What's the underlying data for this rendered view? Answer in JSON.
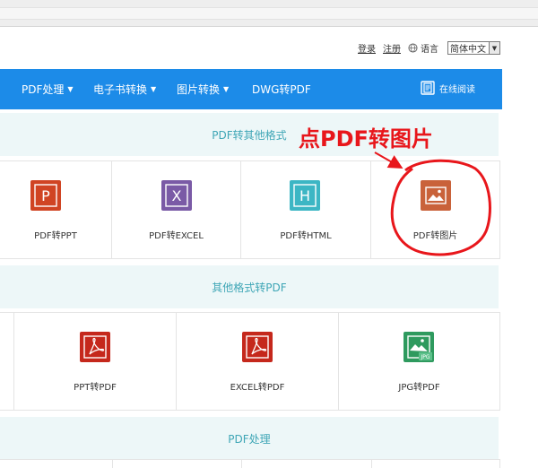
{
  "header": {
    "login": "登录",
    "register": "注册",
    "language_label": "语言",
    "language_value": "简体中文"
  },
  "nav": {
    "items": [
      "PDF处理",
      "电子书转换",
      "图片转换",
      "DWG转PDF"
    ],
    "reader": "在线阅读"
  },
  "sections": [
    {
      "title": "PDF转其他格式",
      "tiles": [
        {
          "label": "PDF转PPT",
          "icon": "ppt-icon",
          "letter": "P",
          "color": "#d04423"
        },
        {
          "label": "PDF转EXCEL",
          "icon": "excel-icon",
          "letter": "X",
          "color": "#7a5aa6"
        },
        {
          "label": "PDF转HTML",
          "icon": "html-icon",
          "letter": "H",
          "color": "#3cb6c4"
        },
        {
          "label": "PDF转图片",
          "icon": "image-icon",
          "letter": "",
          "color": "#c9623a"
        }
      ]
    },
    {
      "title": "其他格式转PDF",
      "tiles": [
        {
          "label": "PPT转PDF",
          "icon": "pdf-icon",
          "color": "#c5281c"
        },
        {
          "label": "EXCEL转PDF",
          "icon": "pdf-icon",
          "color": "#c5281c"
        },
        {
          "label": "JPG转PDF",
          "icon": "jpg-icon",
          "badge": "JPG",
          "color": "#2e9a5e"
        }
      ]
    },
    {
      "title": "PDF处理"
    }
  ],
  "annotation": {
    "text": "点PDF转图片",
    "color": "#e8161b"
  }
}
